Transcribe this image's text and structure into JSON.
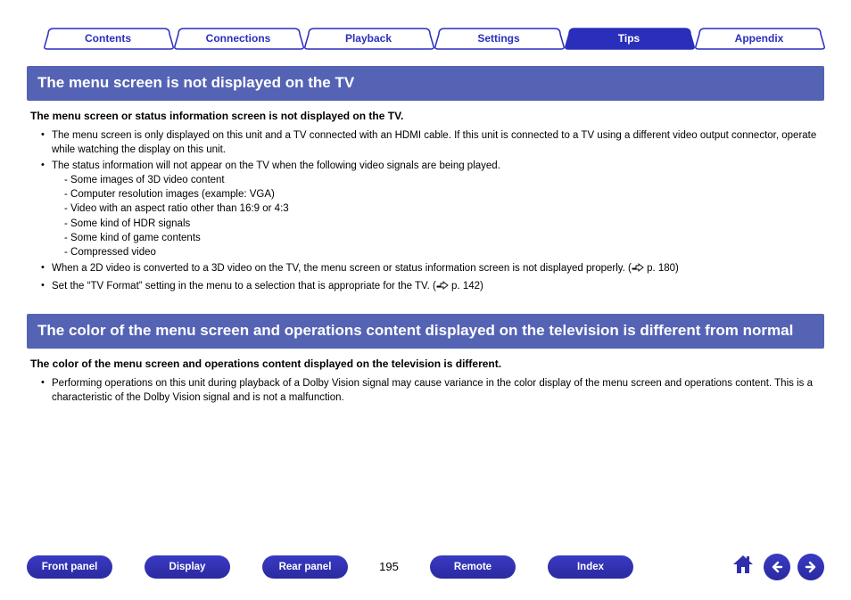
{
  "tabs": [
    {
      "label": "Contents"
    },
    {
      "label": "Connections"
    },
    {
      "label": "Playback"
    },
    {
      "label": "Settings"
    },
    {
      "label": "Tips",
      "active": true
    },
    {
      "label": "Appendix"
    }
  ],
  "section1": {
    "title": "The menu screen is not displayed on the TV",
    "subtitle": "The menu screen or status information screen is not displayed on the TV.",
    "bullets": {
      "b1": "The menu screen is only displayed on this unit and a TV connected with an HDMI cable. If this unit is connected to a TV using a different video output connector, operate while watching the display on this unit.",
      "b2": "The status information will not appear on the TV when the following video signals are being played.",
      "b2_items": [
        "- Some images of 3D video content",
        "- Computer resolution images (example: VGA)",
        "- Video with an aspect ratio other than 16:9 or 4:3",
        "- Some kind of HDR signals",
        "- Some kind of game contents",
        "- Compressed video"
      ],
      "b3_pre": "When a 2D video is converted to a 3D video on the TV, the menu screen or status information screen is not displayed properly.  (",
      "b3_ref": " p. 180)",
      "b4_pre": "Set the “TV Format” setting in the menu to a selection that is appropriate for the TV.  (",
      "b4_ref": " p. 142)"
    }
  },
  "section2": {
    "title": "The color of the menu screen and operations content displayed on the television is different from normal",
    "subtitle": "The color of the menu screen and operations content displayed on the television is different.",
    "bullet": "Performing operations on this unit during playback of a Dolby Vision signal may cause variance in the color display of the menu screen and operations content. This is a characteristic of the Dolby Vision signal and is not a malfunction."
  },
  "bottom": {
    "buttons": [
      "Front panel",
      "Display",
      "Rear panel"
    ],
    "page": "195",
    "buttons2": [
      "Remote",
      "Index"
    ]
  }
}
